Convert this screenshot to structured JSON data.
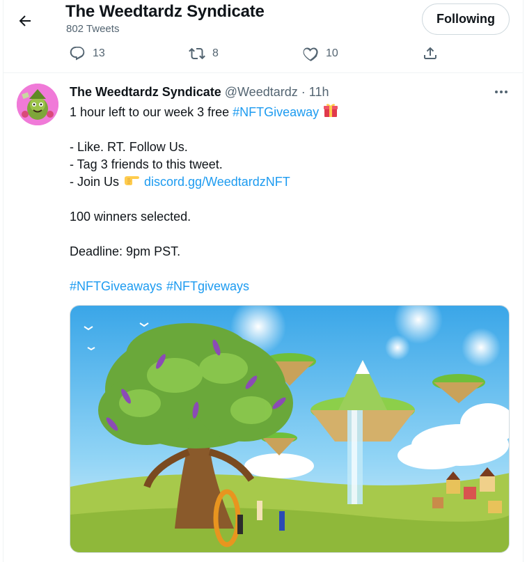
{
  "header": {
    "title": "The Weedtardz Syndicate",
    "tweet_count": "802 Tweets",
    "follow_label": "Following"
  },
  "prev_tweet_actions": {
    "reply_count": "13",
    "retweet_count": "8",
    "like_count": "10"
  },
  "tweet": {
    "name": "The Weedtardz Syndicate",
    "handle": "@Weedtardz",
    "separator": "·",
    "time": "11h",
    "line1_text": "1 hour left to our week 3 free ",
    "line1_hashtag": "#NFTGiveaway",
    "line2": "- Like. RT. Follow Us.",
    "line3": "- Tag 3 friends to this tweet.",
    "line4_text": "- Join Us",
    "line4_link": "discord.gg/WeedtardzNFT",
    "line5": "100 winners selected.",
    "line6": "Deadline: 9pm PST.",
    "hashtag_a": "#NFTGiveaways",
    "hashtag_b": "#NFTgiveways"
  },
  "icons": {
    "back": "arrow-left-icon",
    "reply": "speech-bubble-icon",
    "retweet": "retweet-icon",
    "like": "heart-icon",
    "share": "share-upload-icon",
    "more": "ellipsis-icon",
    "gift": "gift-emoji",
    "pointing": "pointing-hand-emoji"
  },
  "colors": {
    "link": "#1d9bf0",
    "text": "#0f1419",
    "secondary": "#536471",
    "avatar_bg": "#f07ad8"
  }
}
